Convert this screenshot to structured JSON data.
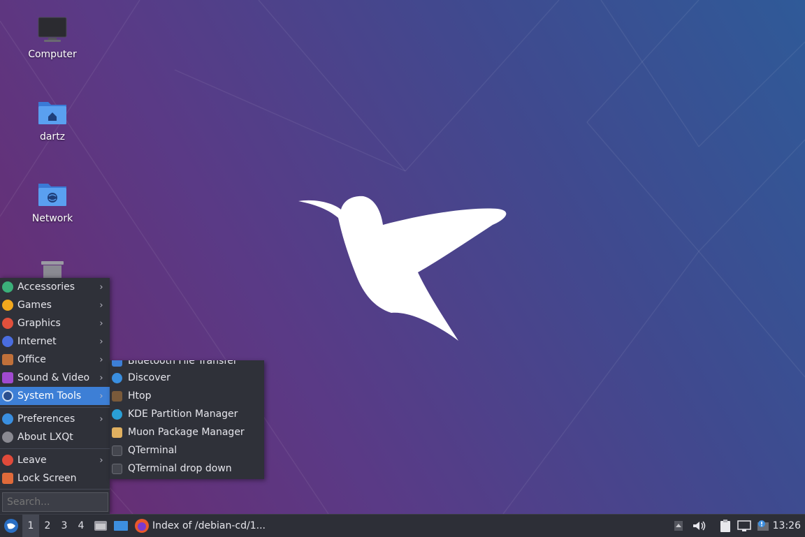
{
  "desktop": {
    "icons": [
      {
        "label": "Computer",
        "icon": "computer-icon"
      },
      {
        "label": "dartz",
        "icon": "home-folder-icon"
      },
      {
        "label": "Network",
        "icon": "network-folder-icon"
      },
      {
        "label": "",
        "icon": "trash-icon"
      }
    ]
  },
  "main_menu": {
    "items": [
      {
        "label": "Accessories",
        "icon": "accessories-icon",
        "color": "#3bb07a"
      },
      {
        "label": "Games",
        "icon": "games-icon",
        "color": "#f2a81d"
      },
      {
        "label": "Graphics",
        "icon": "graphics-icon",
        "color": "#e0503c"
      },
      {
        "label": "Internet",
        "icon": "internet-icon",
        "color": "#4a6de0"
      },
      {
        "label": "Office",
        "icon": "office-icon",
        "color": "#c0703a"
      },
      {
        "label": "Sound & Video",
        "icon": "sound-video-icon",
        "color": "#a04ad0"
      },
      {
        "label": "System Tools",
        "icon": "system-tools-icon",
        "color": "#3d7fd6"
      },
      {
        "label": "Preferences",
        "icon": "preferences-icon",
        "color": "#3a8fe0"
      },
      {
        "label": "About LXQt",
        "icon": "info-icon",
        "color": "#8a8a92"
      },
      {
        "label": "Leave",
        "icon": "leave-icon",
        "color": "#e04a3a"
      },
      {
        "label": "Lock Screen",
        "icon": "lock-icon",
        "color": "#e06a3a"
      }
    ],
    "arrow": "›",
    "search_placeholder": "Search..."
  },
  "system_tools_menu": {
    "items": [
      {
        "label": "Bluetooth File Transfer",
        "icon": "bluetooth-icon",
        "color": "#3d7fd6"
      },
      {
        "label": "Discover",
        "icon": "discover-icon",
        "color": "#3a8fe0"
      },
      {
        "label": "Htop",
        "icon": "htop-icon",
        "color": "#7a5a3a"
      },
      {
        "label": "KDE Partition Manager",
        "icon": "partition-manager-icon",
        "color": "#2a9fd6"
      },
      {
        "label": "Muon Package Manager",
        "icon": "muon-icon",
        "color": "#e0b060"
      },
      {
        "label": "QTerminal",
        "icon": "terminal-icon",
        "color": "#44464e"
      },
      {
        "label": "QTerminal drop down",
        "icon": "terminal-dropdown-icon",
        "color": "#44464e"
      }
    ]
  },
  "taskbar": {
    "workspaces": [
      "1",
      "2",
      "3",
      "4"
    ],
    "active_window_title": "Index of /debian-cd/1...",
    "clock": "13:26"
  }
}
